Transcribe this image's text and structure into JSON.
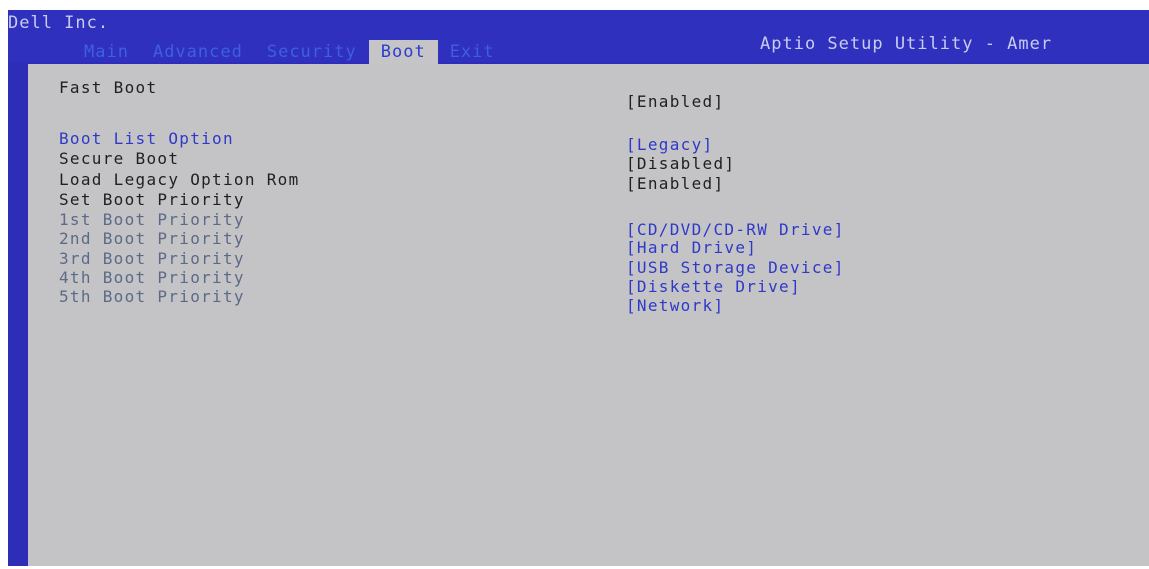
{
  "header": {
    "vendor": "Dell Inc.",
    "utility_title": "Aptio Setup Utility - Amer",
    "tabs": [
      {
        "label": "Main",
        "active": false
      },
      {
        "label": "Advanced",
        "active": false
      },
      {
        "label": "Security",
        "active": false
      },
      {
        "label": "Boot",
        "active": true
      },
      {
        "label": "Exit",
        "active": false
      }
    ]
  },
  "boot": {
    "fast_boot": {
      "label": "Fast Boot",
      "value": "[Enabled]"
    },
    "boot_list_option": {
      "label": "Boot List Option",
      "value": "[Legacy]"
    },
    "secure_boot": {
      "label": "Secure Boot",
      "value": "[Disabled]"
    },
    "load_legacy_option_rom": {
      "label": "Load Legacy Option Rom",
      "value": "[Enabled]"
    },
    "set_boot_priority": {
      "label": "Set Boot Priority"
    },
    "priorities": [
      {
        "label": "1st Boot Priority",
        "value": "[CD/DVD/CD-RW Drive]"
      },
      {
        "label": "2nd Boot Priority",
        "value": "[Hard Drive]"
      },
      {
        "label": "3rd Boot Priority",
        "value": "[USB Storage Device]"
      },
      {
        "label": "4th Boot Priority",
        "value": "[Diskette Drive]"
      },
      {
        "label": "5th Boot Priority",
        "value": "[Network]"
      }
    ]
  },
  "colors": {
    "frame_blue": "#2d2db8",
    "panel_gray": "#c4c4c6",
    "selected_blue": "#2f39c9",
    "dim_text": "#5c6a88",
    "normal_text": "#1f1f24"
  }
}
